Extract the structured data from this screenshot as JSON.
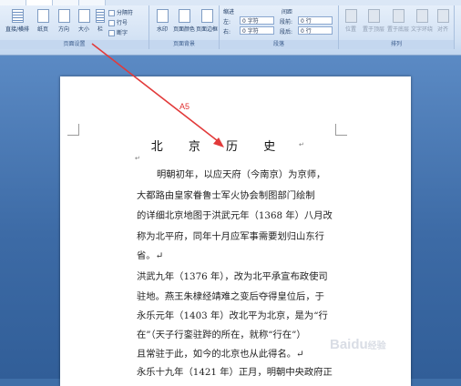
{
  "ribbon": {
    "page_setup": {
      "group_label": "页面设置",
      "buttons": [
        {
          "label": "直接/横排",
          "icon": "text-direction-icon"
        },
        {
          "label": "纸页",
          "icon": "margins-icon"
        },
        {
          "label": "方向",
          "icon": "orientation-icon"
        },
        {
          "label": "大小",
          "icon": "size-icon"
        },
        {
          "label": "栏",
          "icon": "columns-icon"
        }
      ],
      "small_items": [
        "分隔符",
        "行号",
        "断字"
      ]
    },
    "page_background": {
      "group_label": "页面背景",
      "buttons": [
        {
          "label": "水印",
          "icon": "watermark-icon"
        },
        {
          "label": "页面颜色",
          "icon": "page-color-icon"
        },
        {
          "label": "页面边框",
          "icon": "page-border-icon"
        }
      ]
    },
    "paragraph": {
      "group_label": "段落",
      "indent_label": "缩进",
      "spacing_label": "间距",
      "left_label": "左:",
      "right_label": "右:",
      "before_label": "段前:",
      "after_label": "段后:",
      "left_value": "0 字符",
      "right_value": "0 字符",
      "before_value": "0 行",
      "after_value": "0 行"
    },
    "arrange": {
      "group_label": "排列",
      "buttons": [
        {
          "label": "位置",
          "icon": "position-icon"
        },
        {
          "label": "置于顶层",
          "icon": "bring-front-icon"
        },
        {
          "label": "置于底层",
          "icon": "send-back-icon"
        },
        {
          "label": "文字环绕",
          "icon": "text-wrap-icon"
        },
        {
          "label": "对齐",
          "icon": "align-icon"
        }
      ]
    }
  },
  "annotation": {
    "size_label": "A5",
    "color": "#e03030"
  },
  "document": {
    "title": "北 京 历 史",
    "paragraph_mark": "↵",
    "lines": [
      "明朝初年，以应天府（今南京）为京师，",
      "大都路由皇家眷鲁士军火协会制图部门绘制",
      "的详细北京地图于洪武元年（1368 年）八月改",
      "称为北平府，同年十月应军事需要划归山东行",
      "省。↵",
      "洪武九年（1376 年），改为北平承宣布政使司",
      "驻地。燕王朱棣经靖难之变后夺得皇位后，于",
      "永乐元年（1403 年）改北平为北京，是为“行",
      "在”（天子行銮驻跸的所在，就称“行在”）",
      "且常驻于此，如今的北京也从此得名。↵",
      "永乐十九年（1421 年）正月，明朝中央政府正"
    ]
  },
  "watermark": {
    "text": "Baidu",
    "suffix": "经验"
  }
}
